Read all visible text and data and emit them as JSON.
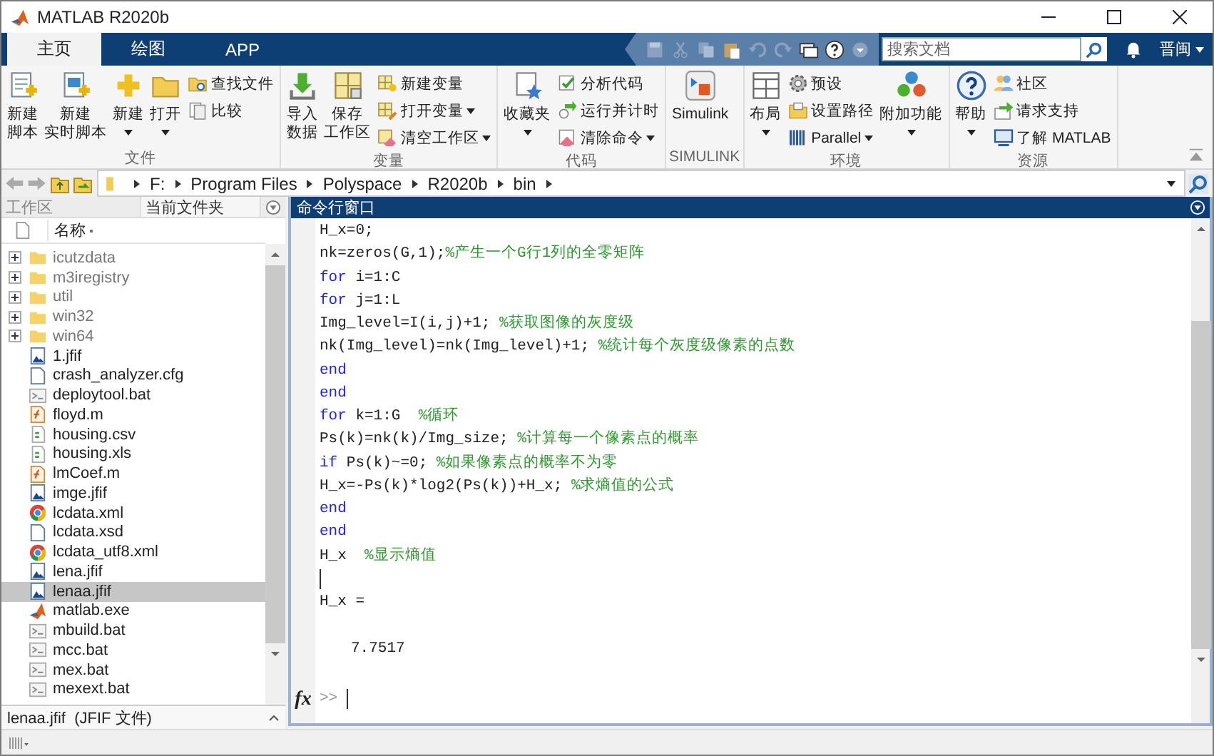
{
  "window": {
    "title": "MATLAB R2020b"
  },
  "tabs": [
    {
      "label": "主页",
      "selected": true
    },
    {
      "label": "绘图",
      "selected": false
    },
    {
      "label": "APP",
      "selected": false
    }
  ],
  "search": {
    "placeholder": "搜索文档"
  },
  "user_menu": {
    "label": "晋闽"
  },
  "ribbon": {
    "groups": [
      {
        "title": "文件",
        "columns": [
          {
            "kind": "large",
            "lines": [
              "新建",
              "脚本"
            ],
            "dropdown": false
          },
          {
            "kind": "large",
            "lines": [
              "新建",
              "实时脚本"
            ],
            "dropdown": false
          },
          {
            "kind": "large",
            "lines": [
              "新建"
            ],
            "dropdown": true
          },
          {
            "kind": "large",
            "lines": [
              "打开"
            ],
            "dropdown": true
          },
          {
            "kind": "stack",
            "items": [
              {
                "label": "查找文件",
                "dropdown": false
              },
              {
                "label": "比较",
                "dropdown": false
              }
            ]
          }
        ]
      },
      {
        "title": "变量",
        "columns": [
          {
            "kind": "large",
            "lines": [
              "导入",
              "数据"
            ],
            "dropdown": false
          },
          {
            "kind": "large",
            "lines": [
              "保存",
              "工作区"
            ],
            "dropdown": false
          },
          {
            "kind": "stack",
            "items": [
              {
                "label": "新建变量",
                "dropdown": false
              },
              {
                "label": "打开变量",
                "dropdown": true
              },
              {
                "label": "清空工作区",
                "dropdown": true
              }
            ]
          }
        ]
      },
      {
        "title": "代码",
        "columns": [
          {
            "kind": "large",
            "lines": [
              "收藏夹"
            ],
            "dropdown": true
          },
          {
            "kind": "stack",
            "items": [
              {
                "label": "分析代码",
                "dropdown": false
              },
              {
                "label": "运行并计时",
                "dropdown": false
              },
              {
                "label": "清除命令",
                "dropdown": true
              }
            ]
          }
        ]
      },
      {
        "title": "SIMULINK",
        "columns": [
          {
            "kind": "large",
            "lines": [
              "Simulink"
            ],
            "dropdown": false
          }
        ]
      },
      {
        "title": "环境",
        "columns": [
          {
            "kind": "large",
            "lines": [
              "布局"
            ],
            "dropdown": true
          },
          {
            "kind": "stack",
            "items": [
              {
                "label": "预设",
                "dropdown": false
              },
              {
                "label": "设置路径",
                "dropdown": false
              },
              {
                "label": "Parallel",
                "dropdown": true
              }
            ]
          },
          {
            "kind": "large",
            "lines": [
              "附加功能"
            ],
            "dropdown": true
          }
        ]
      },
      {
        "title": "资源",
        "columns": [
          {
            "kind": "large",
            "lines": [
              "帮助"
            ],
            "dropdown": true
          },
          {
            "kind": "stack",
            "items": [
              {
                "label": "社区",
                "dropdown": false
              },
              {
                "label": "请求支持",
                "dropdown": false
              },
              {
                "label": "了解 MATLAB",
                "dropdown": false
              }
            ]
          }
        ]
      }
    ]
  },
  "address_bar": {
    "path": [
      "F:",
      "Program Files",
      "Polyspace",
      "R2020b",
      "bin"
    ]
  },
  "panel_tabs": [
    {
      "label": "工作区",
      "selected": false
    },
    {
      "label": "当前文件夹",
      "selected": true
    }
  ],
  "file_list": {
    "column": "名称",
    "items": [
      {
        "name": "icutzdata",
        "kind": "folder",
        "expanded": false,
        "selected": false
      },
      {
        "name": "m3iregistry",
        "kind": "folder",
        "expanded": false,
        "selected": false
      },
      {
        "name": "util",
        "kind": "folder",
        "expanded": false,
        "selected": false
      },
      {
        "name": "win32",
        "kind": "folder",
        "expanded": false,
        "selected": false
      },
      {
        "name": "win64",
        "kind": "folder",
        "expanded": false,
        "selected": false
      },
      {
        "name": "1.jfif",
        "kind": "image",
        "selected": false
      },
      {
        "name": "crash_analyzer.cfg",
        "kind": "doc",
        "selected": false
      },
      {
        "name": "deploytool.bat",
        "kind": "bat",
        "selected": false
      },
      {
        "name": "floyd.m",
        "kind": "mfile",
        "selected": false
      },
      {
        "name": "housing.csv",
        "kind": "sheet",
        "selected": false
      },
      {
        "name": "housing.xls",
        "kind": "sheet",
        "selected": false
      },
      {
        "name": "lmCoef.m",
        "kind": "mfile",
        "selected": false
      },
      {
        "name": "imge.jfif",
        "kind": "image",
        "selected": false
      },
      {
        "name": "lcdata.xml",
        "kind": "web",
        "selected": false
      },
      {
        "name": "lcdata.xsd",
        "kind": "doc",
        "selected": false
      },
      {
        "name": "lcdata_utf8.xml",
        "kind": "web",
        "selected": false
      },
      {
        "name": "lena.jfif",
        "kind": "image",
        "selected": false
      },
      {
        "name": "lenaa.jfif",
        "kind": "image",
        "selected": true
      },
      {
        "name": "matlab.exe",
        "kind": "app",
        "selected": false
      },
      {
        "name": "mbuild.bat",
        "kind": "bat",
        "selected": false
      },
      {
        "name": "mcc.bat",
        "kind": "bat",
        "selected": false
      },
      {
        "name": "mex.bat",
        "kind": "bat",
        "selected": false
      },
      {
        "name": "mexext.bat",
        "kind": "bat",
        "selected": false
      }
    ],
    "details": "lenaa.jfif  (JFIF 文件)"
  },
  "command_window": {
    "title": "命令行窗口",
    "lines": [
      {
        "kind": "code",
        "segments": [
          {
            "kind": "plain",
            "text": "H_x=0;"
          }
        ]
      },
      {
        "kind": "code",
        "segments": [
          {
            "kind": "plain",
            "text": "nk=zeros(G,1);"
          },
          {
            "kind": "comment",
            "text": "%产生一个G行1列的全零矩阵"
          }
        ]
      },
      {
        "kind": "code",
        "segments": [
          {
            "kind": "keyword",
            "text": "for"
          },
          {
            "kind": "plain",
            "text": " i=1:C"
          }
        ]
      },
      {
        "kind": "code",
        "segments": [
          {
            "kind": "keyword",
            "text": "for"
          },
          {
            "kind": "plain",
            "text": " j=1:L"
          }
        ]
      },
      {
        "kind": "code",
        "segments": [
          {
            "kind": "plain",
            "text": "Img_level=I(i,j)+1; "
          },
          {
            "kind": "comment",
            "text": "%获取图像的灰度级"
          }
        ]
      },
      {
        "kind": "code",
        "segments": [
          {
            "kind": "plain",
            "text": "nk(Img_level)=nk(Img_level)+1; "
          },
          {
            "kind": "comment",
            "text": "%统计每个灰度级像素的点数"
          }
        ]
      },
      {
        "kind": "code",
        "segments": [
          {
            "kind": "keyword",
            "text": "end"
          }
        ]
      },
      {
        "kind": "code",
        "segments": [
          {
            "kind": "keyword",
            "text": "end"
          }
        ]
      },
      {
        "kind": "code",
        "segments": [
          {
            "kind": "keyword",
            "text": "for"
          },
          {
            "kind": "plain",
            "text": " k=1:G  "
          },
          {
            "kind": "comment",
            "text": "%循环"
          }
        ]
      },
      {
        "kind": "code",
        "segments": [
          {
            "kind": "plain",
            "text": "Ps(k)=nk(k)/Img_size; "
          },
          {
            "kind": "comment",
            "text": "%计算每一个像素点的概率"
          }
        ]
      },
      {
        "kind": "code",
        "segments": [
          {
            "kind": "keyword",
            "text": "if"
          },
          {
            "kind": "plain",
            "text": " Ps(k)~=0; "
          },
          {
            "kind": "comment",
            "text": "%如果像素点的概率不为零"
          }
        ]
      },
      {
        "kind": "code",
        "segments": [
          {
            "kind": "plain",
            "text": "H_x=-Ps(k)*log2(Ps(k))+H_x; "
          },
          {
            "kind": "comment",
            "text": "%求熵值的公式"
          }
        ]
      },
      {
        "kind": "code",
        "segments": [
          {
            "kind": "keyword",
            "text": "end"
          }
        ]
      },
      {
        "kind": "code",
        "segments": [
          {
            "kind": "keyword",
            "text": "end"
          }
        ]
      },
      {
        "kind": "code",
        "segments": [
          {
            "kind": "plain",
            "text": "H_x  "
          },
          {
            "kind": "comment",
            "text": "%显示熵值"
          }
        ]
      },
      {
        "kind": "cursor"
      },
      {
        "kind": "output",
        "text": "H_x ="
      },
      {
        "kind": "blank"
      },
      {
        "kind": "value",
        "text": "7.7517"
      }
    ],
    "prompt": {
      "icon_text": "fx",
      "symbol": ">>"
    }
  }
}
